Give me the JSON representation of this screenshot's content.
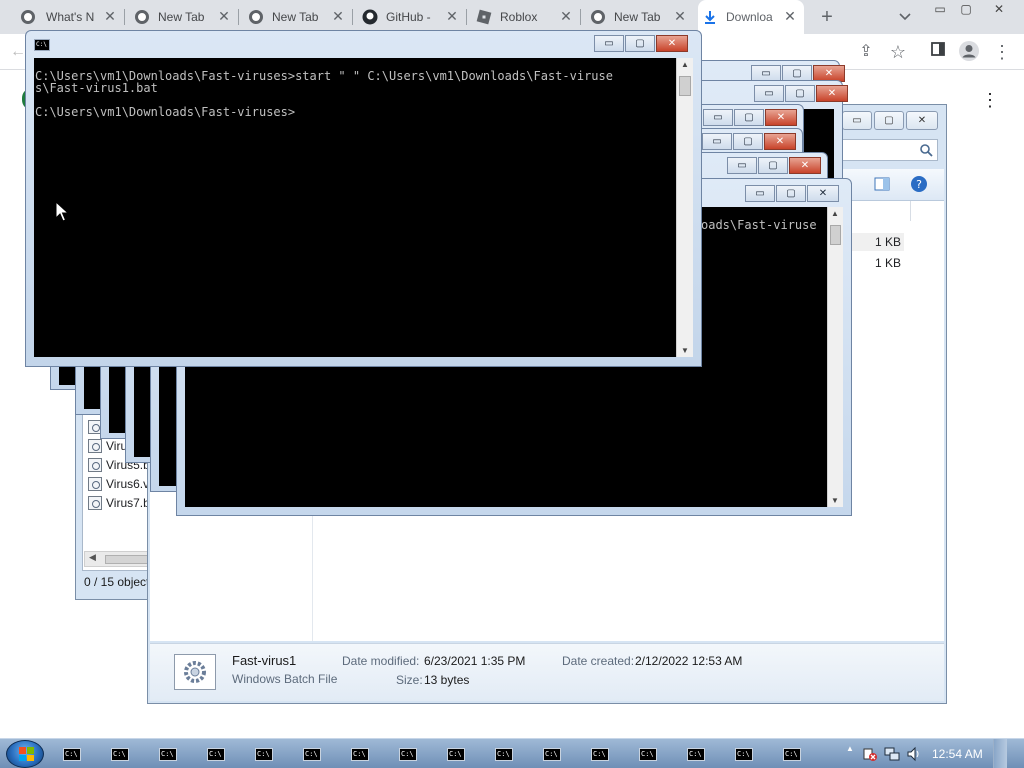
{
  "browser": {
    "tabs": [
      {
        "label": "What's N",
        "icon": "chrome-icon"
      },
      {
        "label": "New Tab",
        "icon": "chrome-icon"
      },
      {
        "label": "New Tab",
        "icon": "chrome-icon"
      },
      {
        "label": "GitHub -",
        "icon": "github-icon"
      },
      {
        "label": "Roblox",
        "icon": "roblox-icon"
      },
      {
        "label": "New Tab",
        "icon": "chrome-icon"
      },
      {
        "label": "Downloa",
        "icon": "download-icon"
      }
    ],
    "new_tab_glyph": "+",
    "tab_close_glyph": "✕",
    "toolbar": {
      "back_glyph": "←",
      "share_glyph": "⇪",
      "star_glyph": "☆",
      "menu_glyph": "⋮"
    }
  },
  "console_main": {
    "icon_text": "C:\\",
    "lines": [
      "C:\\Users\\vm1\\Downloads\\Fast-viruses>start \" \" C:\\Users\\vm1\\Downloads\\Fast-viruse",
      "s\\Fast-virus1.bat",
      "",
      "C:\\Users\\vm1\\Downloads\\Fast-viruses>"
    ]
  },
  "console_back": {
    "visible_text": "oads\\Fast-viruse"
  },
  "explorer": {
    "files": [
      {
        "name": "Viru"
      },
      {
        "name": "Virus5.b"
      },
      {
        "name": "Virus6.v"
      },
      {
        "name": "Virus7.b"
      }
    ],
    "sizes": [
      "1 KB",
      "1 KB"
    ],
    "status": "0 / 15 object",
    "details": {
      "name": "Fast-virus1",
      "type": "Windows Batch File",
      "modified_label": "Date modified:",
      "modified_value": "6/23/2021 1:35 PM",
      "created_label": "Date created:",
      "created_value": "2/12/2022 12:53 AM",
      "size_label": "Size:",
      "size_value": "13 bytes"
    }
  },
  "window_buttons": {
    "minimize": "▭",
    "maximize": "▢",
    "close": "✕"
  },
  "taskbar": {
    "task_icon_text": "C:\\",
    "clock": "12:54 AM"
  }
}
